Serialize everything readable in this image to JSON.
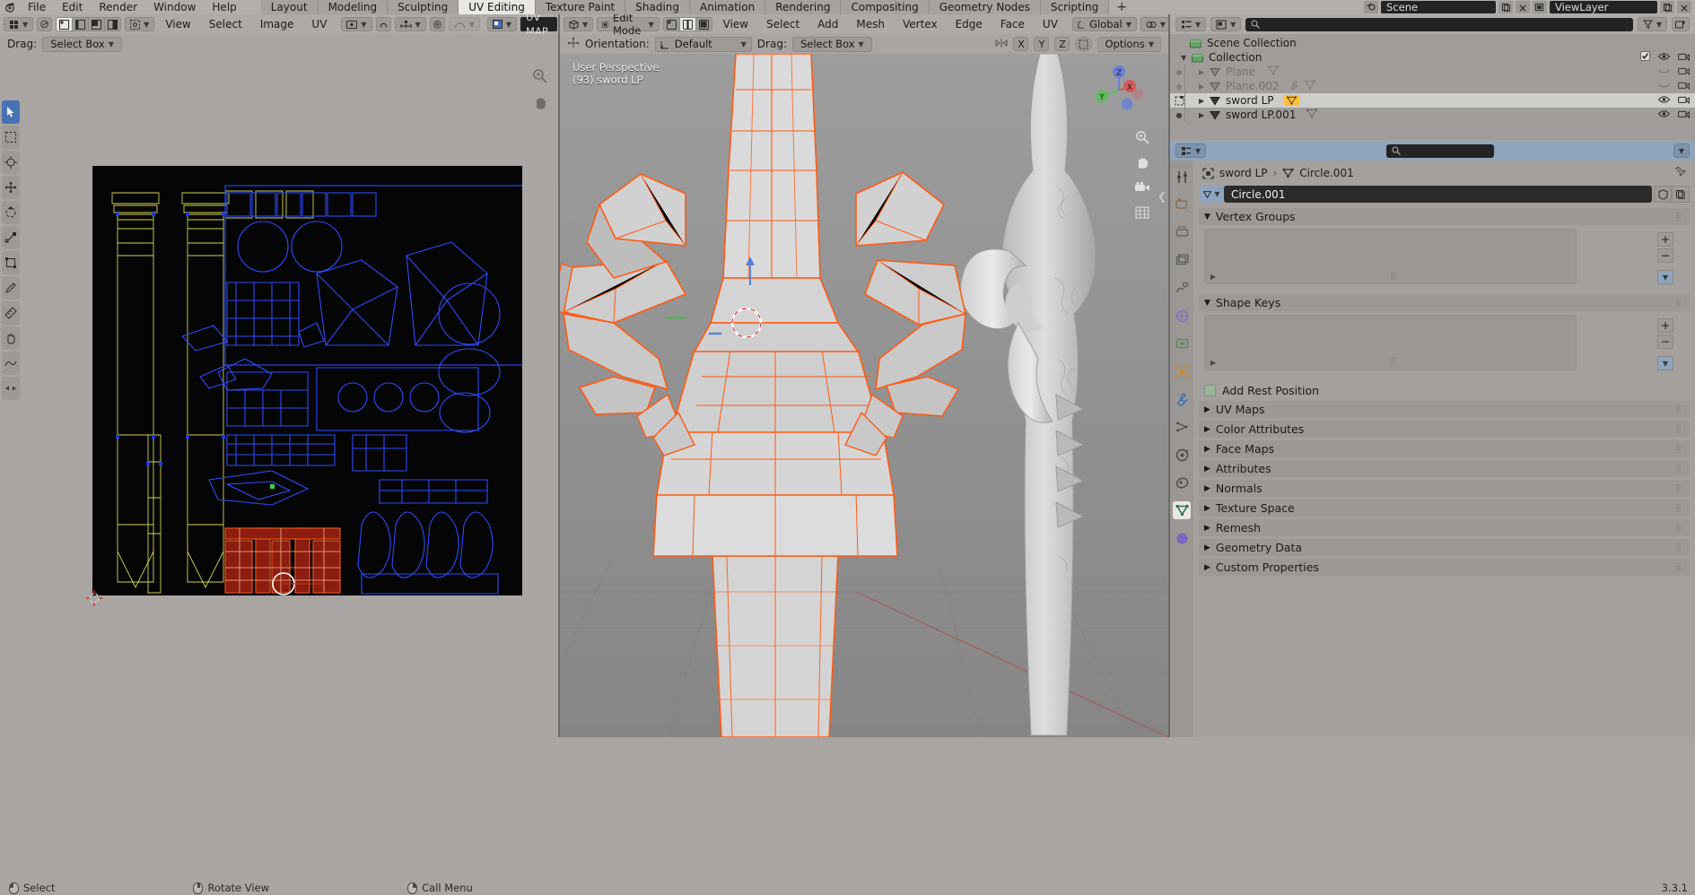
{
  "app": {
    "title": "Blender",
    "menus": [
      "File",
      "Edit",
      "Render",
      "Window",
      "Help"
    ],
    "workspace_tabs": [
      {
        "label": "Layout",
        "active": false
      },
      {
        "label": "Modeling",
        "active": false
      },
      {
        "label": "Sculpting",
        "active": false
      },
      {
        "label": "UV Editing",
        "active": true
      },
      {
        "label": "Texture Paint",
        "active": false
      },
      {
        "label": "Shading",
        "active": false
      },
      {
        "label": "Animation",
        "active": false
      },
      {
        "label": "Rendering",
        "active": false
      },
      {
        "label": "Compositing",
        "active": false
      },
      {
        "label": "Geometry Nodes",
        "active": false
      },
      {
        "label": "Scripting",
        "active": false
      },
      {
        "label": "+",
        "active": false
      }
    ],
    "scene_name": "Scene",
    "viewlayer_name": "ViewLayer"
  },
  "uv_editor": {
    "editor_type": "uv-editor-icon",
    "menus": [
      "View",
      "Select",
      "Image",
      "UV"
    ],
    "image_name": "UV MAP",
    "drag_label": "Drag:",
    "drag_value": "Select Box",
    "select_modes": [
      "vertex",
      "edge",
      "face",
      "island"
    ],
    "pivot": "pivot-center-icon",
    "snap": "snap-magnet-icon",
    "proportional": "proportional-edit-icon",
    "tools": [
      {
        "name": "tweak-tool",
        "active": true
      },
      {
        "name": "select-box-tool",
        "active": false
      },
      {
        "name": "cursor-tool",
        "active": false
      },
      {
        "name": "move-tool",
        "active": false
      },
      {
        "name": "rotate-tool",
        "active": false
      },
      {
        "name": "scale-tool",
        "active": false
      },
      {
        "name": "transform-tool",
        "active": false
      },
      {
        "name": "annotate-tool",
        "active": false
      },
      {
        "name": "measure-tool",
        "active": false
      },
      {
        "name": "grab-uv-tool",
        "active": false
      },
      {
        "name": "relax-uv-tool",
        "active": false
      },
      {
        "name": "pinch-uv-tool",
        "active": false
      }
    ]
  },
  "viewport": {
    "mode": "Edit Mode",
    "menus": [
      "View",
      "Select",
      "Add",
      "Mesh",
      "Vertex",
      "Edge",
      "Face",
      "UV"
    ],
    "transform_orientation": "Global",
    "orientation_label": "Orientation:",
    "orientation_value": "Default",
    "drag_label": "Drag:",
    "drag_value": "Select Box",
    "options_label": "Options",
    "axis_buttons": [
      "X",
      "Y",
      "Z"
    ],
    "overlay_info_line1": "User Perspective",
    "overlay_info_line2": "(93) sword LP",
    "gizmo_axes": [
      "X",
      "Y",
      "Z"
    ],
    "select_modes": [
      "vertex",
      "edge",
      "face"
    ]
  },
  "outliner": {
    "display_mode": "View Layer",
    "search_placeholder": "",
    "filter_icon": "filter-icon",
    "rows": [
      {
        "label": "Scene Collection",
        "depth": 0,
        "type": "collection",
        "dim": false,
        "selected": false,
        "expand": "",
        "checkbox": false,
        "eye": false,
        "camera": false
      },
      {
        "label": "Collection",
        "depth": 1,
        "type": "collection",
        "dim": false,
        "selected": false,
        "expand": "down",
        "checkbox": true,
        "eye": true,
        "camera": true
      },
      {
        "label": "Plane",
        "depth": 2,
        "type": "mesh",
        "dim": true,
        "selected": false,
        "expand": "right",
        "checkbox": false,
        "eye": false,
        "camera": true
      },
      {
        "label": "Plane.002",
        "depth": 2,
        "type": "mesh",
        "dim": true,
        "selected": false,
        "expand": "right",
        "checkbox": false,
        "eye": false,
        "camera": true
      },
      {
        "label": "sword LP",
        "depth": 2,
        "type": "mesh",
        "dim": false,
        "selected": true,
        "expand": "right",
        "checkbox": false,
        "eye": true,
        "camera": true
      },
      {
        "label": "sword LP.001",
        "depth": 2,
        "type": "mesh",
        "dim": false,
        "selected": false,
        "expand": "right",
        "checkbox": false,
        "eye": true,
        "camera": true
      }
    ]
  },
  "properties": {
    "search_placeholder": "",
    "breadcrumb": [
      "sword LP",
      "Circle.001"
    ],
    "data_name": "Circle.001",
    "tabs": [
      {
        "name": "tool-tab",
        "active": false
      },
      {
        "name": "render-tab",
        "active": false
      },
      {
        "name": "output-tab",
        "active": false
      },
      {
        "name": "view-layer-tab",
        "active": false
      },
      {
        "name": "scene-tab",
        "active": false
      },
      {
        "name": "world-tab",
        "active": false
      },
      {
        "name": "collection-tab",
        "active": false
      },
      {
        "name": "object-tab",
        "active": false
      },
      {
        "name": "modifier-tab",
        "active": false
      },
      {
        "name": "particles-tab",
        "active": false
      },
      {
        "name": "physics-tab",
        "active": false
      },
      {
        "name": "constraints-tab",
        "active": false
      },
      {
        "name": "object-data-tab",
        "active": true
      },
      {
        "name": "material-tab",
        "active": false
      }
    ],
    "panels": [
      {
        "label": "Vertex Groups",
        "open": true,
        "has_list": true
      },
      {
        "label": "Shape Keys",
        "open": true,
        "has_list": true
      },
      {
        "label": "UV Maps",
        "open": false,
        "has_list": false
      },
      {
        "label": "Color Attributes",
        "open": false,
        "has_list": false
      },
      {
        "label": "Face Maps",
        "open": false,
        "has_list": false
      },
      {
        "label": "Attributes",
        "open": false,
        "has_list": false
      },
      {
        "label": "Normals",
        "open": false,
        "has_list": false
      },
      {
        "label": "Texture Space",
        "open": false,
        "has_list": false
      },
      {
        "label": "Remesh",
        "open": false,
        "has_list": false
      },
      {
        "label": "Geometry Data",
        "open": false,
        "has_list": false
      },
      {
        "label": "Custom Properties",
        "open": false,
        "has_list": false
      }
    ],
    "add_rest_position": "Add Rest Position"
  },
  "statusbar": {
    "items": [
      {
        "icon": "mouse-left",
        "label": "Select"
      },
      {
        "icon": "mouse-middle",
        "label": "Rotate View"
      },
      {
        "icon": "mouse-right",
        "label": "Call Menu"
      }
    ],
    "version": "3.3.1"
  },
  "colors": {
    "accent_blue": "#4772b3",
    "header_gray": "#adaaa7",
    "panel_gray": "#a3a09d",
    "selection_orange": "#ff6a1f",
    "uv_yellow": "#d8e04a",
    "uv_blue": "#2d4bff",
    "uv_red": "#c03020"
  }
}
